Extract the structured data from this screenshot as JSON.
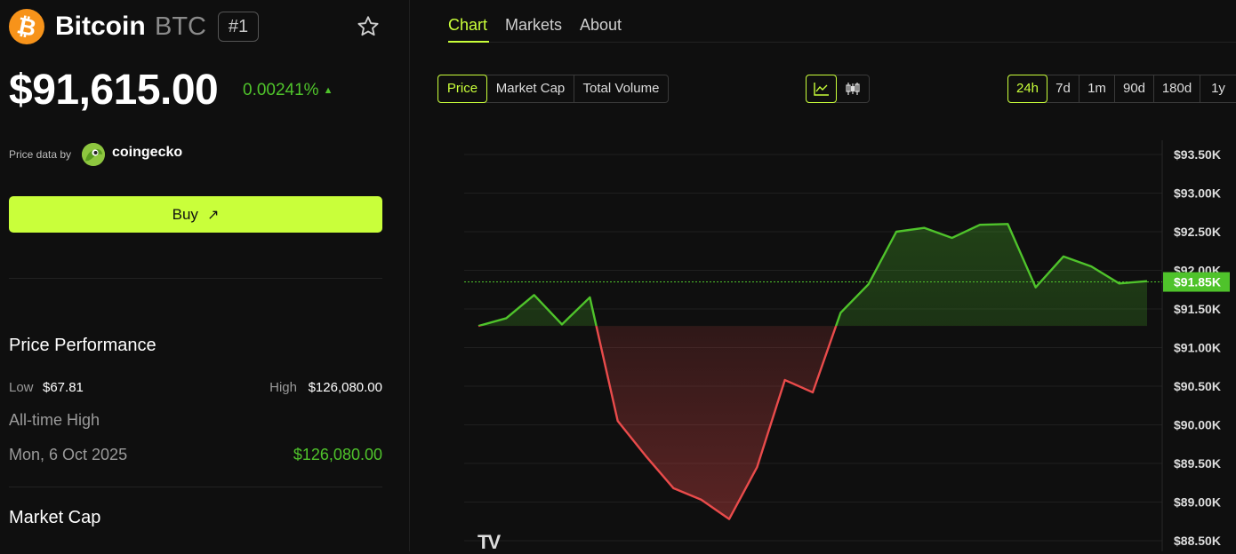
{
  "coin": {
    "name": "Bitcoin",
    "symbol": "BTC",
    "rank": "#1",
    "icon": "bitcoin-logo",
    "price": "$91,615.00",
    "change": "0.00241%",
    "change_direction_icon": "triangle-up-icon"
  },
  "price_source": {
    "label": "Price data by",
    "brand": "coingecko"
  },
  "buy_button": {
    "label": "Buy",
    "icon": "arrow-up-right-icon"
  },
  "performance": {
    "heading": "Price Performance",
    "low_label": "Low",
    "low_value": "$67.81",
    "high_label": "High",
    "high_value": "$126,080.00",
    "ath_label": "All-time High",
    "ath_date": "Mon, 6 Oct 2025",
    "ath_value": "$126,080.00"
  },
  "market_cap": {
    "heading": "Market Cap"
  },
  "tabs": [
    {
      "label": "Chart",
      "active": true
    },
    {
      "label": "Markets",
      "active": false
    },
    {
      "label": "About",
      "active": false
    }
  ],
  "metric_buttons": [
    {
      "label": "Price",
      "active": true
    },
    {
      "label": "Market Cap",
      "active": false
    },
    {
      "label": "Total Volume",
      "active": false
    }
  ],
  "chart_type_buttons": [
    {
      "icon": "line-chart-icon",
      "active": true
    },
    {
      "icon": "candlestick-icon",
      "active": false
    }
  ],
  "range_buttons": [
    {
      "label": "24h",
      "active": true
    },
    {
      "label": "7d",
      "active": false
    },
    {
      "label": "1m",
      "active": false
    },
    {
      "label": "90d",
      "active": false
    },
    {
      "label": "180d",
      "active": false
    },
    {
      "label": "1y",
      "active": false
    }
  ],
  "colors": {
    "accent": "#c9ff3a",
    "up": "#4fc32b",
    "down": "#e94b4b",
    "background": "#0f0f0f",
    "bitcoin": "#f7931a"
  },
  "chart_data": {
    "type": "area",
    "ylim": [
      88500,
      93500
    ],
    "baseline": 91280,
    "current_label": "$91.85K",
    "current_value": 91850,
    "y_ticks": [
      {
        "value": 93500,
        "label": "$93.50K"
      },
      {
        "value": 93000,
        "label": "$93.00K"
      },
      {
        "value": 92500,
        "label": "$92.50K"
      },
      {
        "value": 92000,
        "label": "$92.00K"
      },
      {
        "value": 91500,
        "label": "$91.50K"
      },
      {
        "value": 91000,
        "label": "$91.00K"
      },
      {
        "value": 90500,
        "label": "$90.50K"
      },
      {
        "value": 90000,
        "label": "$90.00K"
      },
      {
        "value": 89500,
        "label": "$89.50K"
      },
      {
        "value": 89000,
        "label": "$89.00K"
      },
      {
        "value": 88500,
        "label": "$88.50K"
      }
    ],
    "series": [
      {
        "values": [
          91280,
          91380,
          91680,
          91300,
          91650,
          90050,
          89600,
          89180,
          89030,
          88780,
          89450,
          90580,
          90420,
          91450,
          91820,
          92500,
          92550,
          92420,
          92590,
          92600,
          91780,
          92180,
          92050,
          91830,
          91860
        ]
      }
    ],
    "watermark": "TV"
  }
}
